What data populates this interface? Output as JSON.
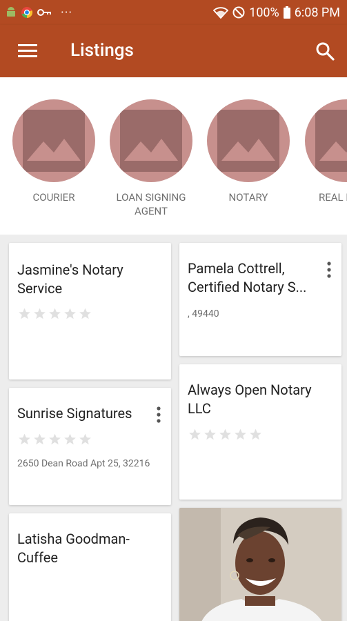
{
  "status_bar": {
    "battery": "100%",
    "time": "6:08 PM",
    "more": "···",
    "icons": [
      "android-icon",
      "chrome-icon",
      "key-icon",
      "wifi-icon",
      "do-not-disturb-icon",
      "battery-icon"
    ]
  },
  "app_bar": {
    "title": "Listings",
    "menu_icon": "hamburger-menu-icon",
    "search_icon": "search-icon",
    "color": "#b24a22"
  },
  "categories": [
    {
      "label": "COURIER",
      "icon": "image-placeholder-icon"
    },
    {
      "label": "LOAN SIGNING AGENT",
      "icon": "image-placeholder-icon"
    },
    {
      "label": "NOTARY",
      "icon": "image-placeholder-icon"
    },
    {
      "label": "REAL E AGE",
      "icon": "image-placeholder-icon"
    }
  ],
  "listings": [
    {
      "title": "Jasmine's Notary Service",
      "rating": 0,
      "address": ""
    },
    {
      "title": "Pamela Cottrell, Certified Notary S...",
      "rating": null,
      "address": ", 49440",
      "menu_icon": "more-vert-icon"
    },
    {
      "title": "Sunrise Signatures",
      "rating": 0,
      "address": "2650 Dean Road Apt 25, 32216",
      "menu_icon": "more-vert-icon"
    },
    {
      "title": "Always Open Notary LLC",
      "rating": 0,
      "address": ""
    },
    {
      "title": "Latisha Goodman-Cuffee",
      "rating": null,
      "address": ""
    },
    {
      "title": "",
      "image": "profile-photo"
    }
  ],
  "colors": {
    "accent": "#b24a22",
    "placeholder": "#c7908d",
    "background": "#ededed",
    "star_empty": "#e0e0e0"
  }
}
